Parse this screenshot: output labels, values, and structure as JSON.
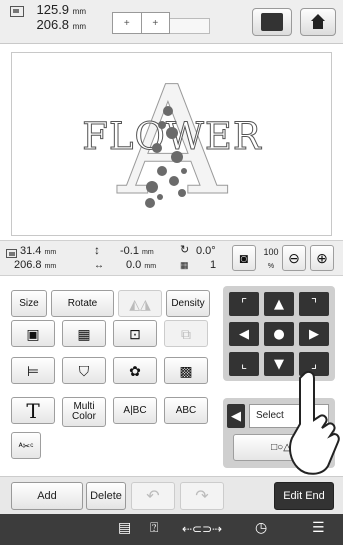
{
  "topbar": {
    "pattern_width": "125.9",
    "pattern_height": "206.8",
    "unit": "mm",
    "frame_buttons": [
      "+",
      "+"
    ]
  },
  "infobar": {
    "size_w": "31.4",
    "size_h": "206.8",
    "offset_v": "-0.1",
    "offset_h": "0.0",
    "unit": "mm",
    "rotation": "0.0°",
    "color_count": "1",
    "zoom_level": "100",
    "zoom_unit": "%"
  },
  "canvas": {
    "word": "FLOWER",
    "letter": "A"
  },
  "tools": {
    "size": "Size",
    "rotate": "Rotate",
    "density": "Density",
    "text_t": "T",
    "multi_color_1": "Multi",
    "multi_color_2": "Color",
    "abc_split": "A|BC",
    "abc_box": "ABC",
    "abc_cut": "A͟B͟C"
  },
  "select_panel": {
    "label": "Select",
    "shapes": "□○△"
  },
  "bottom": {
    "add": "Add",
    "delete": "Delete",
    "edit_end": "Edit End"
  }
}
